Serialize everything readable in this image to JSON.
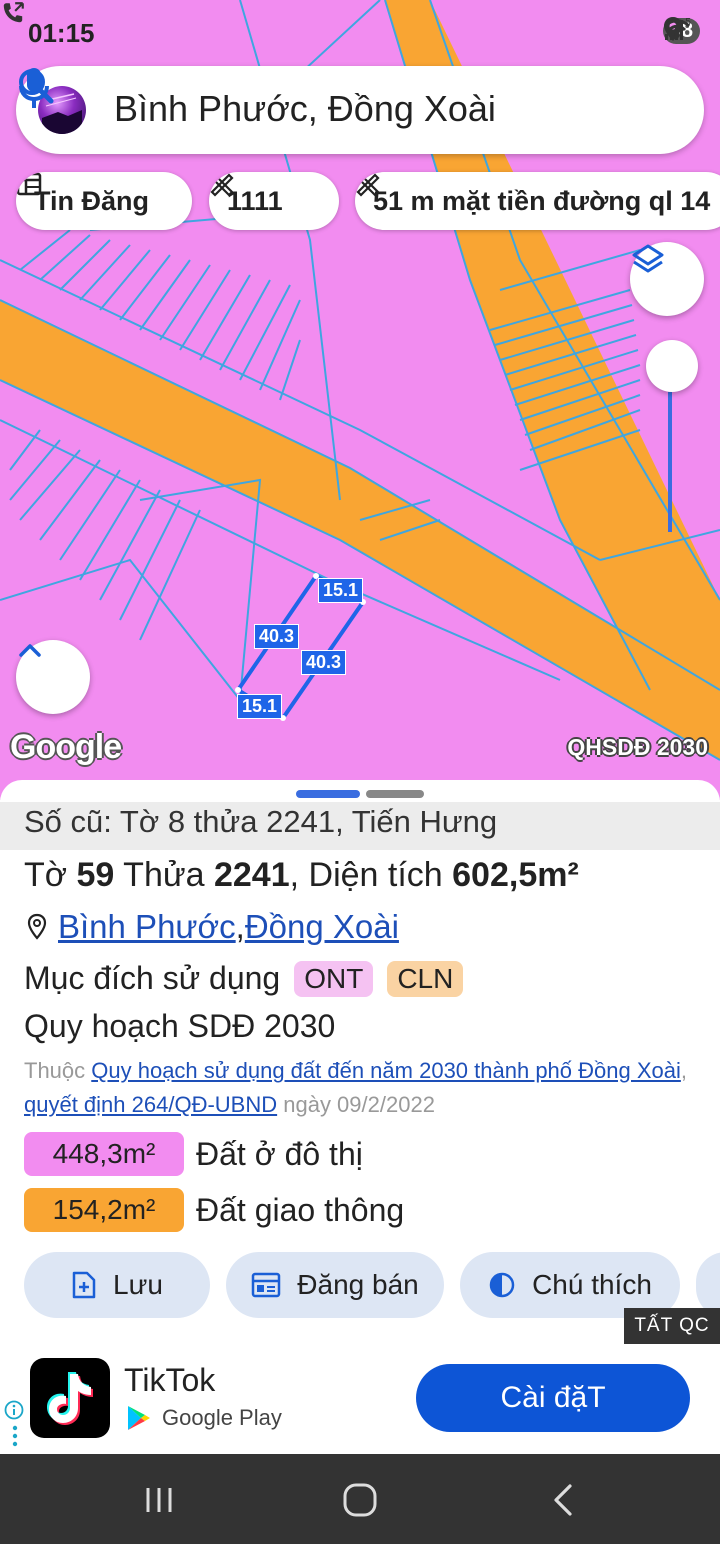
{
  "status": {
    "time": "01:15",
    "battery": "38"
  },
  "search": {
    "query": "Bình Phước, Đồng Xoài"
  },
  "chips": [
    {
      "label": "Tin Đăng"
    },
    {
      "label": "1111"
    },
    {
      "label": "51 m mặt tiền đường ql 14"
    }
  ],
  "map": {
    "attribution": "Google",
    "layer_label": "QHSDĐ 2030",
    "dimensions": {
      "top": "15.1",
      "left": "40.3",
      "right": "40.3",
      "bottom": "15.1"
    },
    "colors": {
      "residential": "#f28cf0",
      "road": "#f9a533",
      "lines": "#3fa6e0",
      "parcel": "#1f65e8"
    }
  },
  "sheet": {
    "old_record": "Số cũ: Tờ 8 thửa 2241, Tiến Hưng",
    "parcel": {
      "sheet_prefix": "Tờ ",
      "sheet_no": "59",
      "plot_prefix": " Thửa ",
      "plot_no": "2241",
      "area_prefix": ", Diện tích ",
      "area": "602,5m²"
    },
    "location": {
      "province": "Bình Phước",
      "separator": ", ",
      "city": "Đồng Xoài"
    },
    "purpose": {
      "label": "Mục đích sử dụng",
      "tags": [
        "ONT",
        "CLN"
      ]
    },
    "plan": {
      "heading": "Quy hoạch SDĐ 2030",
      "belongs_prefix": "Thuộc ",
      "plan_link": "Quy hoạch sử dụng đất đến năm 2030 thành phố Đồng Xoài",
      "separator": ", ",
      "decision_link": "quyết định 264/QĐ-UBND",
      "date": " ngày 09/2/2022"
    },
    "areas": [
      {
        "value": "448,3m²",
        "label": "Đất ở đô thị"
      },
      {
        "value": "154,2m²",
        "label": "Đất giao thông"
      }
    ],
    "actions": [
      {
        "label": "Lưu"
      },
      {
        "label": "Đăng bán"
      },
      {
        "label": "Chú thích"
      }
    ],
    "close_ads": "TẤT QC"
  },
  "ad": {
    "app_name": "TikTok",
    "store": "Google Play",
    "install": "Cài đặT"
  }
}
